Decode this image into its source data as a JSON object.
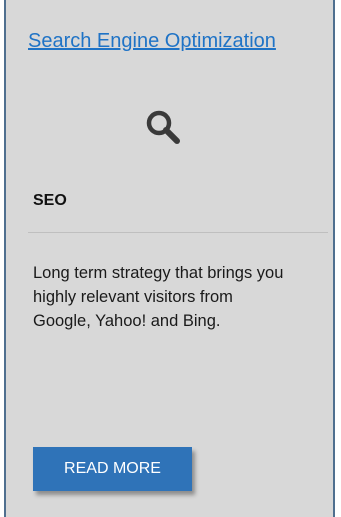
{
  "card": {
    "link_text": "Search Engine Optimization",
    "icon": "search-icon",
    "heading": "SEO",
    "description": "Long term strategy that brings you highly relevant visitors from Google, Yahoo! and Bing.",
    "button_label": "READ MORE"
  },
  "colors": {
    "link": "#1f73c6",
    "button": "#2f73b8",
    "card_background": "#d8d8d8",
    "border": "#4f6f8f"
  }
}
